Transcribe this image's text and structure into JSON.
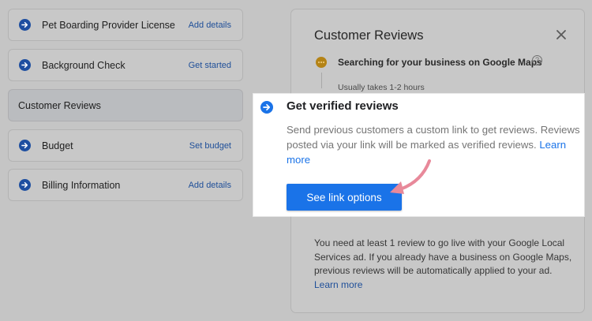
{
  "checklist": {
    "items": [
      {
        "label": "Pet Boarding Provider License",
        "action": "Add details"
      },
      {
        "label": "Background Check",
        "action": "Get started"
      },
      {
        "label": "Customer Reviews"
      },
      {
        "label": "Budget",
        "action": "Set budget"
      },
      {
        "label": "Billing Information",
        "action": "Add details"
      }
    ]
  },
  "panel": {
    "title": "Customer Reviews",
    "close_icon": "close-icon",
    "status": "Searching for your business on Google Maps",
    "status_sub": "Usually takes 1-2 hours",
    "help_icon": "help-icon",
    "help_glyph": "?",
    "note": "You need at least 1 review to go live with your Google Local Services ad. If you already have a business on Google Maps, previous reviews will be automatically applied to your ad.",
    "note_link": "Learn more"
  },
  "callout": {
    "title": "Get verified reviews",
    "body": "Send previous customers a custom link to get reviews. Reviews posted via your link will be marked as verified reviews.",
    "link": "Learn more",
    "button": "See link options"
  },
  "colors": {
    "accent": "#1a73e8",
    "pointer": "#e8899a",
    "status_dot": "#b48316"
  }
}
